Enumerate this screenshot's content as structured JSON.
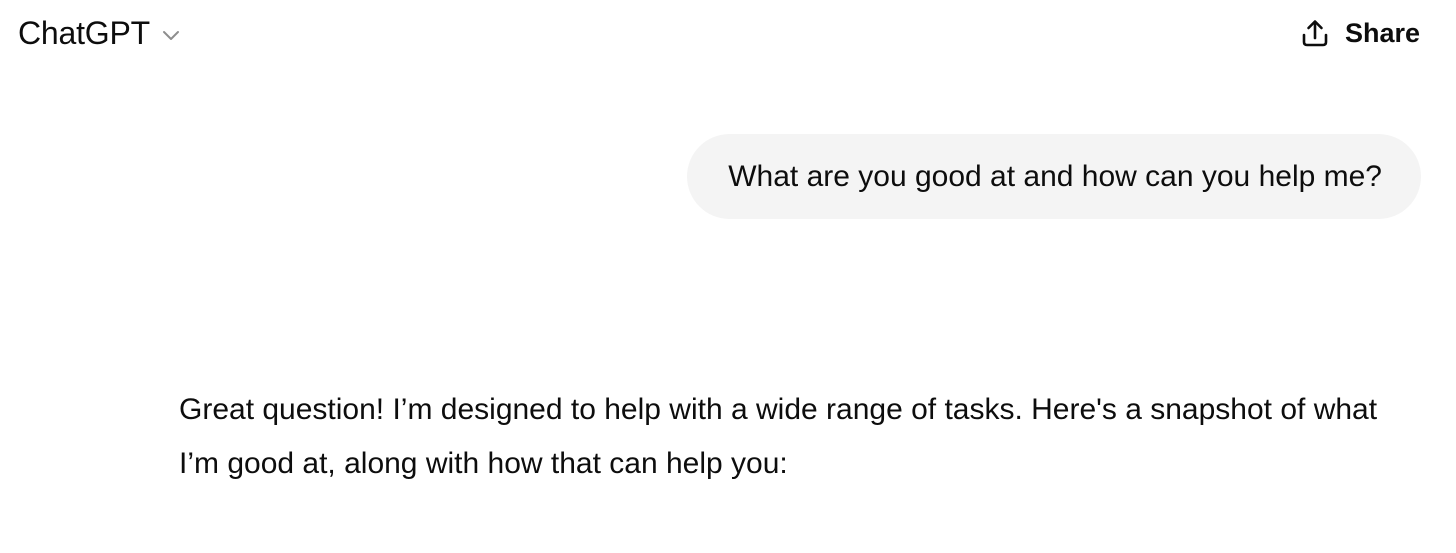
{
  "header": {
    "model_name": "ChatGPT",
    "model_dropdown_icon": "chevron-down-icon",
    "share_label": "Share",
    "share_icon": "share-upload-icon"
  },
  "conversation": {
    "user_message": "What are you good at and how can you help me?",
    "assistant_message": "Great question! I’m designed to help with a wide range of tasks. Here's a snapshot of what I’m good at, along with how that can help you:"
  },
  "colors": {
    "background": "#ffffff",
    "text": "#0d0d0d",
    "user_bubble": "#f4f4f4",
    "icon_muted": "#8e8e8e"
  }
}
